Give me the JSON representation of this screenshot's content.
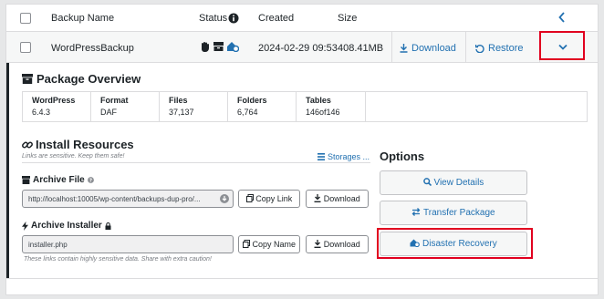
{
  "header": {
    "col_name": "Backup Name",
    "col_status": "Status",
    "col_created": "Created",
    "col_size": "Size"
  },
  "backup": {
    "name": "WordPressBackup",
    "created": "2024-02-29 09:53",
    "size": "408.41MB",
    "download_label": "Download",
    "restore_label": "Restore"
  },
  "package": {
    "title": "Package Overview",
    "columns": [
      {
        "label": "WordPress",
        "value": "6.4.3"
      },
      {
        "label": "Format",
        "value": "DAF"
      },
      {
        "label": "Files",
        "value": "37,137"
      },
      {
        "label": "Folders",
        "value": "6,764"
      },
      {
        "label": "Tables",
        "value": "146of146"
      }
    ]
  },
  "install": {
    "title": "Install Resources",
    "note": "Links are sensitive. Keep them safe!",
    "storages_label": "Storages ...",
    "archive_file_label": "Archive File",
    "archive_file_url": "http://localhost:10005/wp-content/backups-dup-pro/...",
    "copy_link_label": "Copy Link",
    "download_label": "Download",
    "archive_installer_label": "Archive Installer",
    "installer_name": "installer.php",
    "copy_name_label": "Copy Name",
    "download2_label": "Download",
    "footer_note": "These links contain highly sensitive data. Share with extra caution!"
  },
  "options": {
    "title": "Options",
    "view_details": "View Details",
    "transfer_package": "Transfer Package",
    "disaster_recovery": "Disaster Recovery"
  },
  "colors": {
    "accent": "#2271b1",
    "highlight": "#e1001f",
    "text": "#1d2327"
  },
  "icons": [
    "info-icon",
    "chevron-left-icon",
    "chevron-down-icon",
    "hand-icon",
    "archive-icon",
    "home-recovery-icon",
    "download-icon",
    "restore-icon",
    "package-icon",
    "link-icon",
    "storages-icon",
    "question-icon",
    "lightning-icon",
    "lock-icon",
    "search-icon",
    "transfer-icon"
  ]
}
